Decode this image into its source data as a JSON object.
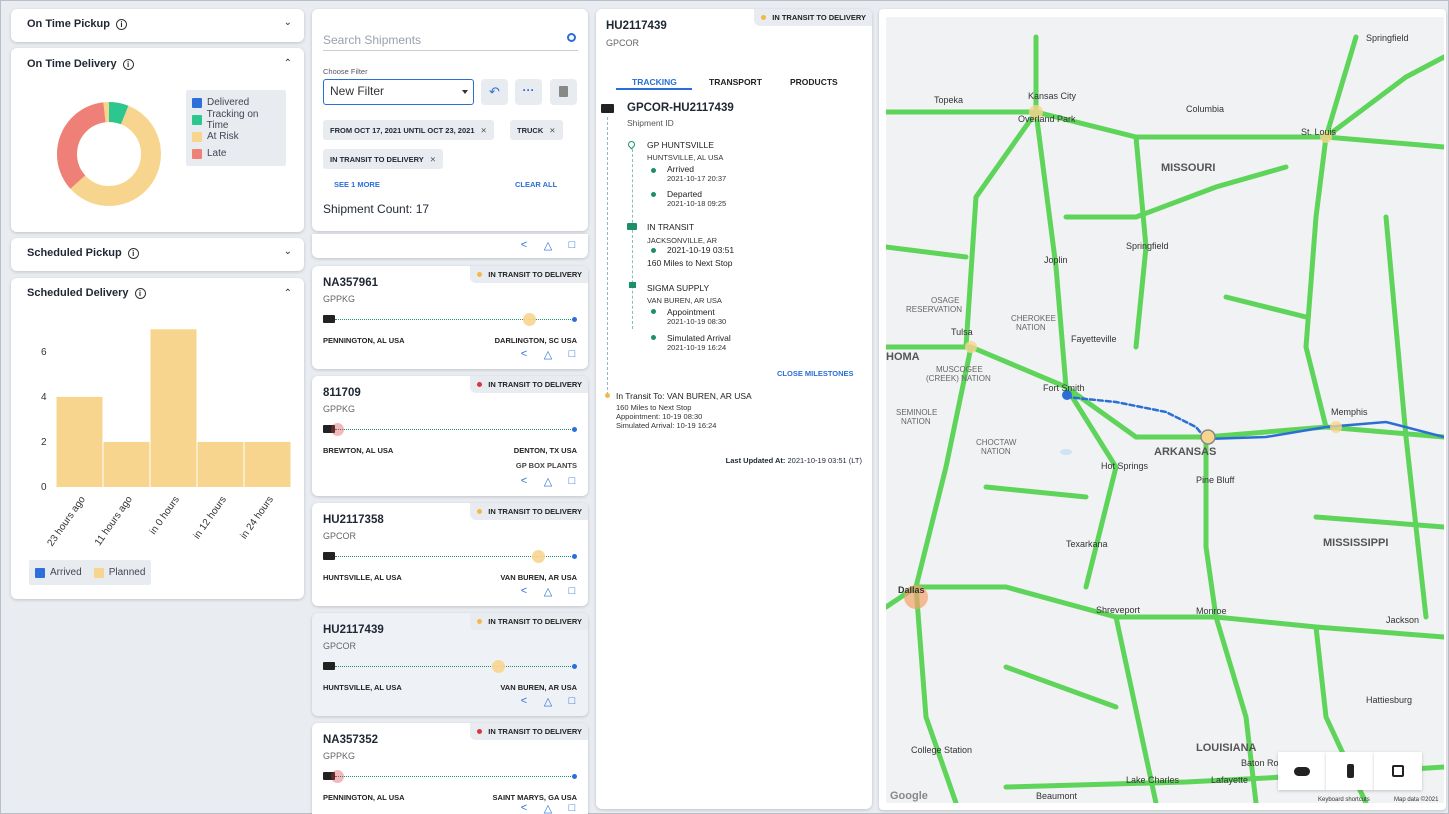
{
  "widgets": {
    "on_time_pickup": "On Time Pickup",
    "on_time_delivery": "On Time Delivery",
    "scheduled_pickup": "Scheduled Pickup",
    "scheduled_delivery": "Scheduled Delivery",
    "info_glyph": "i"
  },
  "delivery_donut": {
    "legend": [
      "Delivered",
      "Tracking on Time",
      "At Risk",
      "Late"
    ],
    "colors": {
      "delivered": "#2f6fdb",
      "tracking_on_time": "#2cc68f",
      "at_risk": "#f8d58f",
      "late": "#ef8078"
    }
  },
  "chart_data": {
    "type": "bar",
    "categories": [
      "23 hours ago",
      "11 hours ago",
      "in 0 hours",
      "in 12 hours",
      "in 24 hours"
    ],
    "series": [
      {
        "name": "Arrived",
        "values": [
          0,
          0,
          0,
          0,
          0
        ]
      },
      {
        "name": "Planned",
        "values": [
          4,
          2,
          7,
          2,
          2
        ]
      }
    ],
    "yticks": [
      "0",
      "2",
      "4",
      "6"
    ],
    "ylim": [
      0,
      7.5
    ],
    "legend": [
      "Arrived",
      "Planned"
    ],
    "colors": {
      "arrived": "#2f6fdb",
      "planned": "#f8d58f"
    }
  },
  "filter_panel": {
    "search_placeholder": "Search Shipments",
    "choose_filter_label": "Choose Filter",
    "filter_value": "New Filter",
    "chips": [
      "FROM OCT 17, 2021 UNTIL OCT 23, 2021",
      "TRUCK",
      "IN TRANSIT TO DELIVERY"
    ],
    "see_more": "SEE 1 MORE",
    "clear_all": "CLEAR ALL",
    "shipment_count": "Shipment Count: 17"
  },
  "shipments": [
    {
      "id": "NA357961",
      "shipper": "GPPKG",
      "status": "IN TRANSIT TO DELIVERY",
      "status_color": "#f2b84b",
      "from": "PENNINGTON, AL USA",
      "to": "DARLINGTON, SC USA",
      "extra": "",
      "progress": 0.82
    },
    {
      "id": "811709",
      "shipper": "GPPKG",
      "status": "IN TRANSIT TO DELIVERY",
      "status_color": "#d9363e",
      "from": "BREWTON, AL USA",
      "to": "DENTON, TX USA",
      "extra": "GP BOX PLANTS",
      "progress": 0.0
    },
    {
      "id": "HU2117358",
      "shipper": "GPCOR",
      "status": "IN TRANSIT TO DELIVERY",
      "status_color": "#f2b84b",
      "from": "HUNTSVILLE, AL USA",
      "to": "VAN BUREN, AR USA",
      "extra": "",
      "progress": 0.86
    },
    {
      "id": "HU2117439",
      "shipper": "GPCOR",
      "status": "IN TRANSIT TO DELIVERY",
      "status_color": "#f2b84b",
      "from": "HUNTSVILLE, AL USA",
      "to": "VAN BUREN, AR USA",
      "extra": "",
      "progress": 0.69
    },
    {
      "id": "NA357352",
      "shipper": "GPPKG",
      "status": "IN TRANSIT TO DELIVERY",
      "status_color": "#d9363e",
      "from": "PENNINGTON, AL USA",
      "to": "SAINT MARYS, GA USA",
      "extra": "",
      "progress": 0.0
    }
  ],
  "detail": {
    "id": "HU2117439",
    "shipper": "GPCOR",
    "status": "IN TRANSIT TO DELIVERY",
    "tabs": [
      "TRACKING",
      "TRANSPORT",
      "PRODUCTS"
    ],
    "shipment_title": "GPCOR-HU2117439",
    "shipment_id_label": "Shipment ID",
    "stop1_name": "GP HUNTSVILLE",
    "stop1_loc": "HUNTSVILLE, AL USA",
    "arrived_label": "Arrived",
    "arrived_time": "2021-10-17 20:37",
    "departed_label": "Departed",
    "departed_time": "2021-10-18 09:25",
    "transit_name": "IN TRANSIT",
    "transit_loc": "JACKSONVILLE, AR",
    "transit_time": "2021-10-19 03:51",
    "transit_miles": "160 Miles to Next Stop",
    "stop2_name": "SIGMA SUPPLY",
    "stop2_loc": "VAN BUREN, AR USA",
    "appointment_label": "Appointment",
    "appointment_time": "2021-10-19 08:30",
    "sim_label": "Simulated Arrival",
    "sim_time": "2021-10-19 16:24",
    "close_milestones": "CLOSE MILESTONES",
    "summary_title": "In Transit To: VAN BUREN, AR USA",
    "summary_l1": "160 Miles to Next Stop",
    "summary_l2": "Appointment: 10-19 08:30",
    "summary_l3": "Simulated Arrival: 10-19 16:24",
    "last_updated_label": "Last Updated At:",
    "last_updated_value": "2021-10-19 03:51 (LT)"
  },
  "map": {
    "labels": {
      "kansas_city": "Kansas City",
      "overland_park": "Overland Park",
      "topeka": "Topeka",
      "springfield_n": "Springfield",
      "columbia": "Columbia",
      "st_louis": "St. Louis",
      "missouri": "MISSOURI",
      "springfield": "Springfield",
      "joplin": "Joplin",
      "osage": "OSAGE",
      "reservation": "RESERVATION",
      "cherokee": "CHEROKEE",
      "nation": "NATION",
      "tulsa": "Tulsa",
      "fayetteville": "Fayetteville",
      "homa": "HOMA",
      "muscogee": "MUSCOGEE",
      "creek_nation": "(CREEK) NATION",
      "fort_smith": "Fort Smith",
      "seminole": "SEMINOLE",
      "choctaw": "CHOCTAW",
      "arkansas": "ARKANSAS",
      "memphis": "Memphis",
      "hot_springs": "Hot Springs",
      "pine_bluff": "Pine Bluff",
      "mississippi": "MISSISSIPPI",
      "texarkana": "Texarkana",
      "dallas": "Dallas",
      "shreveport": "Shreveport",
      "monroe": "Monroe",
      "jackson": "Jackson",
      "louisiana": "LOUISIANA",
      "college_station": "College Station",
      "lake_charles": "Lake Charles",
      "lafayette": "Lafayette",
      "baton_rouge": "Baton Rouge",
      "beaumont": "Beaumont",
      "hattiesburg": "Hattiesburg",
      "google": "Google",
      "keyboard_shortcuts": "Keyboard shortcuts",
      "map_data": "Map data ©2021"
    },
    "buttons": [
      "cloud",
      "traffic-light",
      "image"
    ],
    "highway_color": "#5fd45a",
    "route_color": "#2b6fd6"
  }
}
